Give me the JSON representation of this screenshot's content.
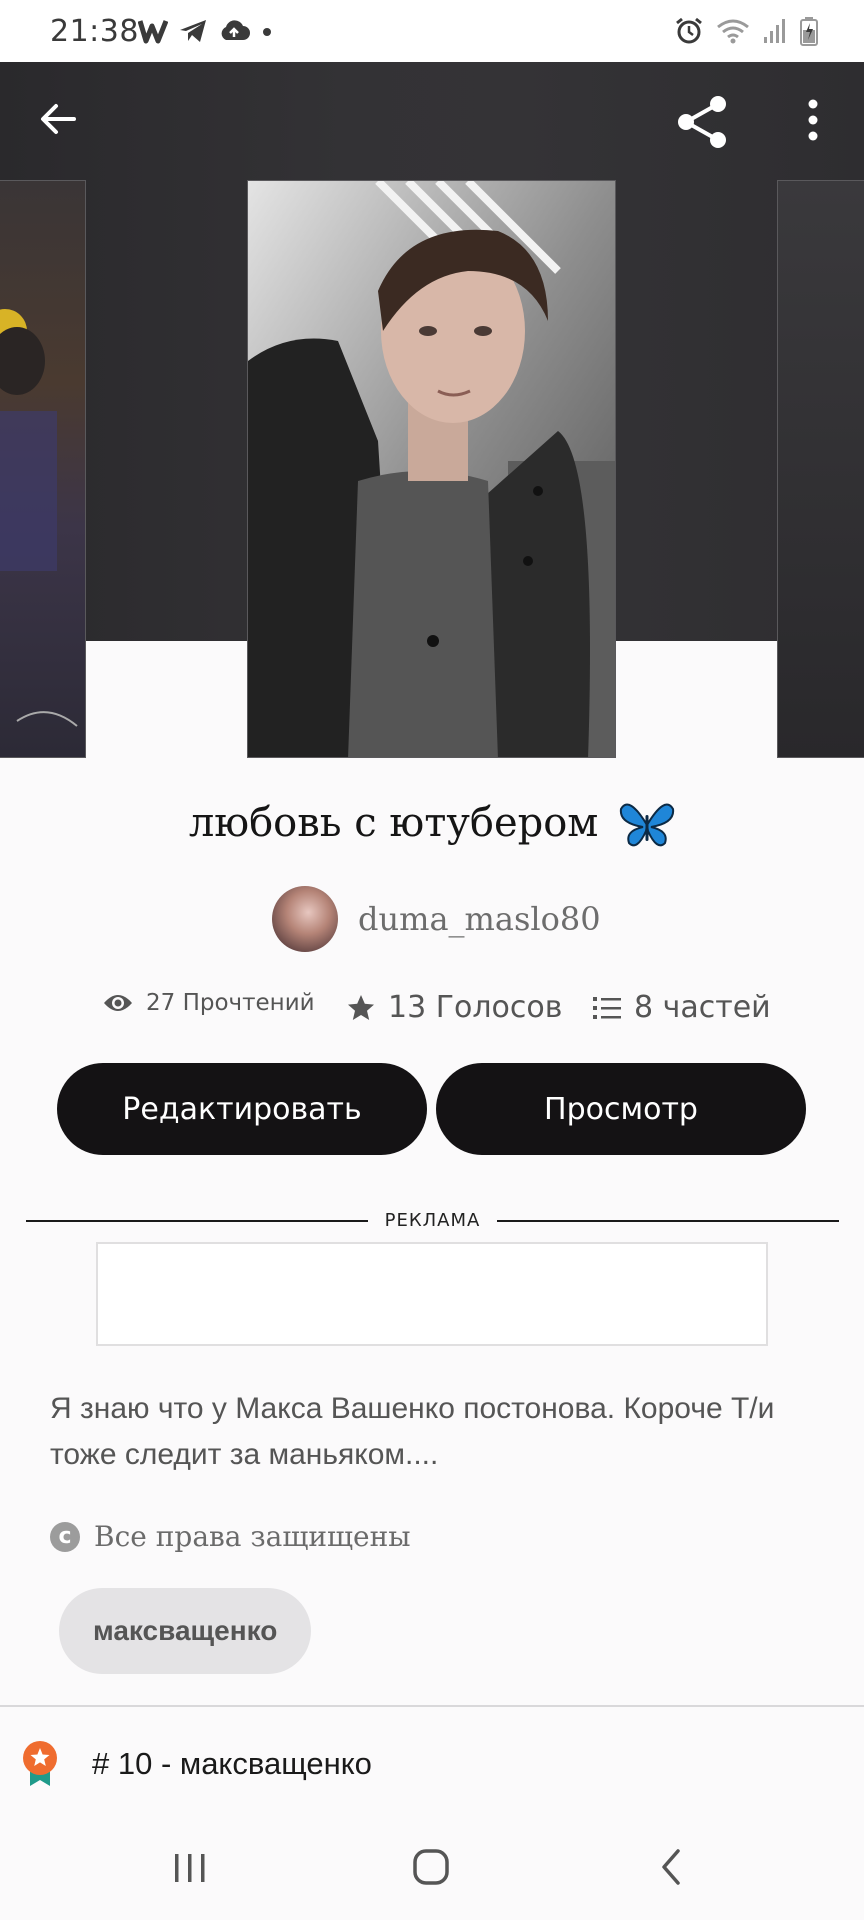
{
  "status_bar": {
    "time": "21:38",
    "left_icons": [
      "w-app-icon",
      "telegram-icon",
      "cloud-upload-icon",
      "dot-icon"
    ],
    "right_icons": [
      "alarm-icon",
      "wifi-icon",
      "signal-icon",
      "battery-icon"
    ]
  },
  "header": {
    "back_icon": "arrow-left-icon",
    "share_icon": "share-icon",
    "more_icon": "more-vertical-icon"
  },
  "story": {
    "title": "любовь с ютубером",
    "title_emoji": "butterfly-icon",
    "author": "duma_maslo80",
    "stats": {
      "reads": "27 Прочтений",
      "votes": "13 Голосов",
      "parts": "8 частей"
    },
    "description": "Я знаю что у Макса Вашенко постонова. Короче Т/и тоже следит за маньяком....",
    "rights": "Все права защищены",
    "tag": "максващенко",
    "rank": "# 10 - максващенко"
  },
  "buttons": {
    "edit": "Редактировать",
    "view": "Просмотр"
  },
  "ad": {
    "label": "РЕКЛАМА"
  },
  "colors": {
    "header_bg": "#333235",
    "button_bg": "#141214",
    "chip_bg": "#e4e3e5",
    "badge_orange": "#ef6c2f",
    "badge_teal": "#1f9a8a"
  },
  "nav_bar": {
    "icons": [
      "recent-apps-icon",
      "home-icon",
      "back-nav-icon"
    ]
  }
}
